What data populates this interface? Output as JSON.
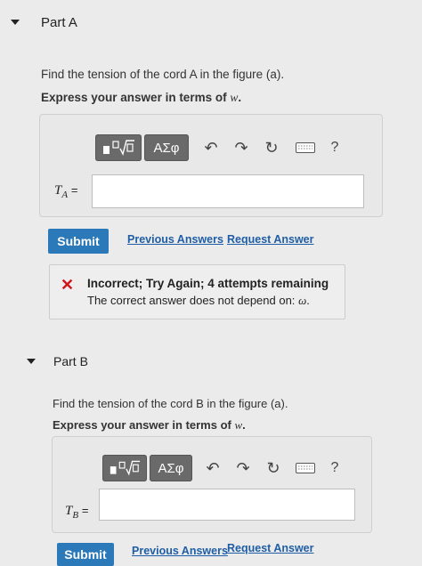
{
  "part_a": {
    "title": "Part A",
    "prompt": "Find the tension of the cord A in the figure (a).",
    "instruction_prefix": "Express your answer in terms of",
    "instruction_var": "w",
    "instruction_suffix": ".",
    "var_label": "T",
    "var_sub": "A",
    "equals": "=",
    "answer_value": "",
    "toolbar": {
      "template_icon": "sqrt-template-icon",
      "greek_label": "ΑΣφ",
      "help_label": "?"
    },
    "submit_label": "Submit",
    "previous_answers_label": "Previous Answers",
    "request_answer_label": "Request Answer",
    "feedback": {
      "title": "Incorrect; Try Again; 4 attempts remaining",
      "body_prefix": "The correct answer does not depend on:",
      "body_var": "ω",
      "body_suffix": ".",
      "status_color": "#d0141a"
    }
  },
  "part_b": {
    "title": "Part B",
    "prompt": "Find the tension of the cord B in the figure (a).",
    "instruction_prefix": "Express your answer in terms of",
    "instruction_var": "w",
    "instruction_suffix": ".",
    "var_label": "T",
    "var_sub": "B",
    "equals": "=",
    "answer_value": "",
    "toolbar": {
      "greek_label": "ΑΣφ",
      "help_label": "?"
    },
    "submit_label": "Submit",
    "previous_answers_label": "Previous Answers",
    "request_answer_label": "Request Answer"
  },
  "colors": {
    "submit": "#2b79b8",
    "link": "#1f5ea6",
    "toolbar_button": "#6a6a6a"
  }
}
